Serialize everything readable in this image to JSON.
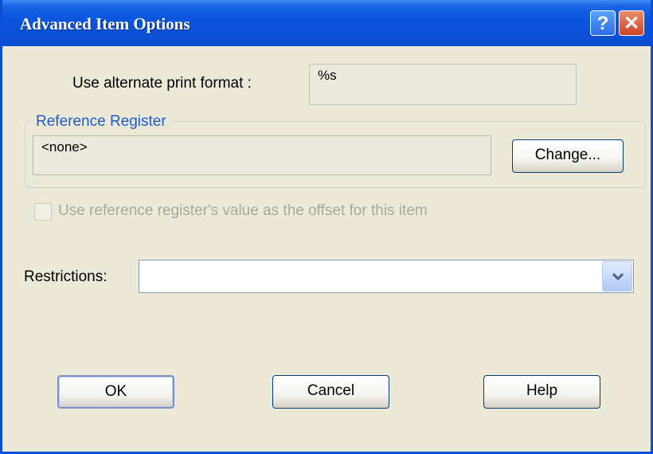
{
  "window": {
    "title": "Advanced Item Options",
    "help_glyph": "?",
    "close_glyph": "✕"
  },
  "print_format": {
    "label": "Use alternate print format :",
    "value": "%s"
  },
  "reference_register": {
    "group_label": "Reference Register",
    "value": "<none>",
    "change_label": "Change..."
  },
  "offset_checkbox": {
    "label": "Use reference register's value as the offset for this item",
    "checked": false
  },
  "restrictions": {
    "label": "Restrictions:",
    "value": ""
  },
  "buttons": {
    "ok": "OK",
    "cancel": "Cancel",
    "help": "Help"
  },
  "icons": {
    "help": "help-icon",
    "close": "close-icon",
    "dropdown": "chevron-down-icon"
  },
  "colors": {
    "titlebar": "#0a4fd6",
    "dialog_bg": "#ece9d8",
    "group_title": "#1f5dc6"
  }
}
